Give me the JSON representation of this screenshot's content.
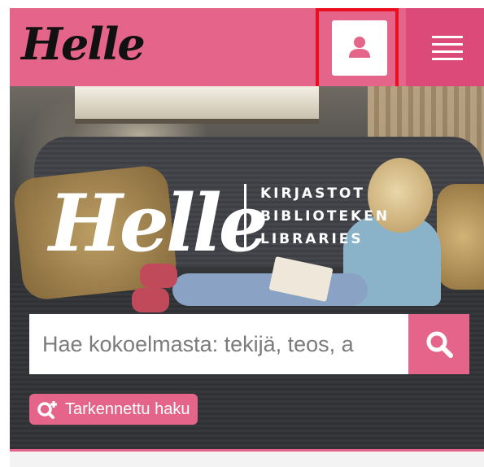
{
  "header": {
    "logo_text": "Helle",
    "user_icon": "user-icon",
    "menu_icon": "hamburger-menu-icon"
  },
  "hero": {
    "brand_logo_text": "Helle",
    "taglines": [
      "KIRJASTOT",
      "BIBLIOTEKEN",
      "LIBRARIES"
    ]
  },
  "search": {
    "placeholder": "Hae kokoelmasta: tekijä, teos, a",
    "value": "",
    "search_icon": "search-icon"
  },
  "advanced_search": {
    "label": "Tarkennettu haku",
    "icon": "search-plus-icon"
  },
  "colors": {
    "brand_pink": "#e5658a",
    "menu_pink": "#dc4a79",
    "highlight_red": "#e8101e"
  }
}
